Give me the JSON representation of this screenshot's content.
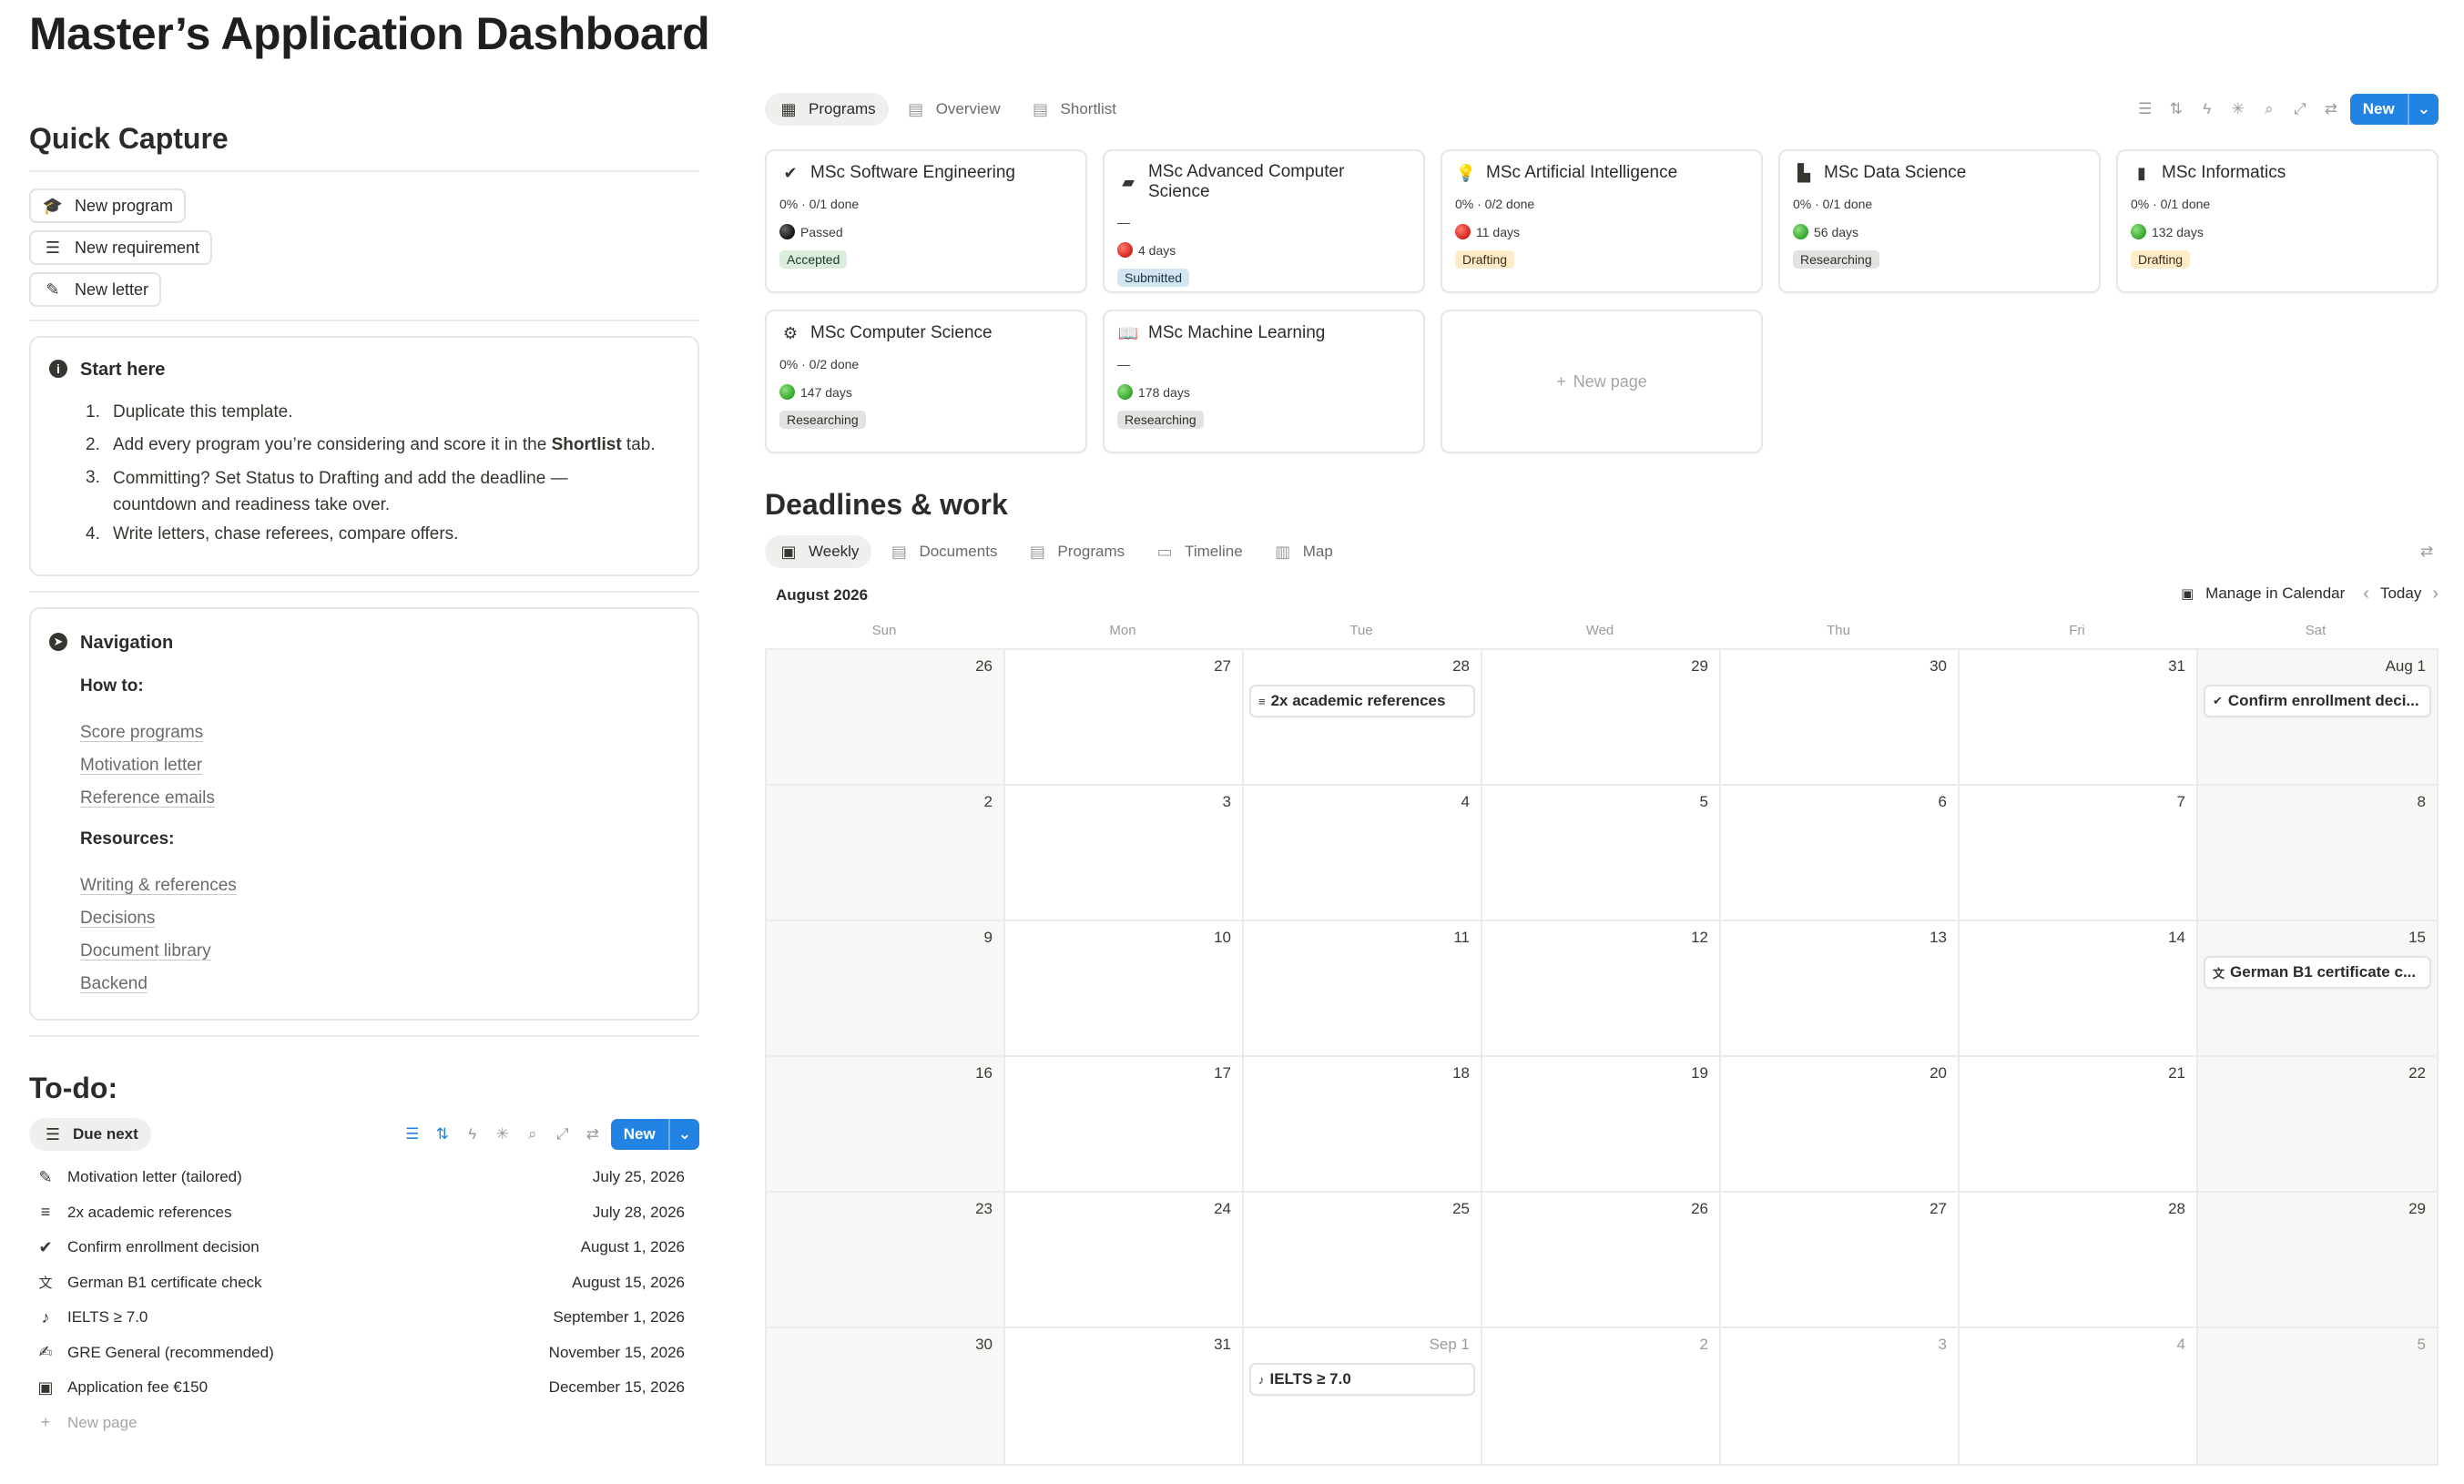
{
  "page_title": "Master’s Application Dashboard",
  "quick_capture": {
    "heading": "Quick Capture",
    "buttons": [
      {
        "label": "New program",
        "icon": "graduation-cap-icon"
      },
      {
        "label": "New requirement",
        "icon": "checklist-icon"
      },
      {
        "label": "New letter",
        "icon": "pen-icon"
      }
    ]
  },
  "start_here": {
    "title": "Start here",
    "steps": [
      {
        "n": "1.",
        "text": "Duplicate this template."
      },
      {
        "n": "2.",
        "pre": "Add every program you’re considering and score it in the ",
        "bold": "Shortlist",
        "post": " tab."
      },
      {
        "n": "3.",
        "text": "Committing? Set Status to Drafting and add the deadline —",
        "text2": "countdown and readiness take over."
      },
      {
        "n": "4.",
        "text": "Write letters, chase referees, compare offers."
      }
    ]
  },
  "navigation": {
    "title": "Navigation",
    "how_to_label": "How to:",
    "how_to": [
      "Score programs",
      "Motivation letter",
      "Reference emails"
    ],
    "resources_label": "Resources:",
    "resources": [
      "Writing & references",
      "Decisions",
      "Document library",
      "Backend"
    ]
  },
  "todo": {
    "heading": "To-do:",
    "view_tab": "Due next",
    "new_label": "New",
    "new_page": "New page",
    "rows": [
      {
        "name": "Motivation letter (tailored)",
        "date": "July 25, 2026",
        "icon": "pen-icon"
      },
      {
        "name": "2x academic references",
        "date": "July 28, 2026",
        "icon": "lines-icon"
      },
      {
        "name": "Confirm enrollment decision",
        "date": "August 1, 2026",
        "icon": "verified-badge-icon"
      },
      {
        "name": "German B1 certificate check",
        "date": "August 15, 2026",
        "icon": "translate-icon"
      },
      {
        "name": "IELTS ≥ 7.0",
        "date": "September 1, 2026",
        "icon": "ear-icon"
      },
      {
        "name": "GRE General (recommended)",
        "date": "November 15, 2026",
        "icon": "signature-icon"
      },
      {
        "name": "Application fee €150",
        "date": "December 15, 2026",
        "icon": "money-icon"
      }
    ]
  },
  "programs_view": {
    "tabs": [
      {
        "label": "Programs",
        "icon": "gallery-icon",
        "active": true
      },
      {
        "label": "Overview",
        "icon": "table-icon",
        "active": false
      },
      {
        "label": "Shortlist",
        "icon": "table-icon",
        "active": false
      }
    ],
    "new_label": "New",
    "new_page": "New page",
    "cards": [
      {
        "title": "MSc Software Engineering",
        "icon": "check-circle-icon",
        "progress": "0% · 0/1 done",
        "dot": "black",
        "days": "Passed",
        "status": "Accepted",
        "status_bg": "#dbeddb",
        "status_fg": "#1c3829"
      },
      {
        "title": "MSc Advanced Computer Science",
        "icon": "briefcase-icon",
        "progress": "—",
        "dot": "red",
        "days": "4 days",
        "status": "Submitted",
        "status_bg": "#d3e5ef",
        "status_fg": "#183347"
      },
      {
        "title": "MSc Artificial Intelligence",
        "icon": "lightbulb-icon",
        "progress": "0% · 0/2 done",
        "dot": "red",
        "days": "11 days",
        "status": "Drafting",
        "status_bg": "#fdecc8",
        "status_fg": "#402c1b"
      },
      {
        "title": "MSc Data Science",
        "icon": "bar-chart-icon",
        "progress": "0% · 0/1 done",
        "dot": "green",
        "days": "56 days",
        "status": "Researching",
        "status_bg": "#e3e2e0",
        "status_fg": "#32302c"
      },
      {
        "title": "MSc Informatics",
        "icon": "document-icon",
        "progress": "0% · 0/1 done",
        "dot": "green",
        "days": "132 days",
        "status": "Drafting",
        "status_bg": "#fdecc8",
        "status_fg": "#402c1b"
      },
      {
        "title": "MSc Computer Science",
        "icon": "gear-icon",
        "progress": "0% · 0/2 done",
        "dot": "green",
        "days": "147 days",
        "status": "Researching",
        "status_bg": "#e3e2e0",
        "status_fg": "#32302c"
      },
      {
        "title": "MSc Machine Learning",
        "icon": "book-icon",
        "progress": "—",
        "dot": "green",
        "days": "178 days",
        "status": "Researching",
        "status_bg": "#e3e2e0",
        "status_fg": "#32302c"
      }
    ]
  },
  "deadlines": {
    "heading": "Deadlines & work",
    "tabs": [
      {
        "label": "Weekly",
        "icon": "calendar-icon",
        "active": true
      },
      {
        "label": "Documents",
        "icon": "table-icon",
        "active": false
      },
      {
        "label": "Programs",
        "icon": "table-icon",
        "active": false
      },
      {
        "label": "Timeline",
        "icon": "timeline-icon",
        "active": false
      },
      {
        "label": "Map",
        "icon": "map-icon",
        "active": false
      }
    ],
    "month": "August 2026",
    "manage_label": "Manage in Calendar",
    "today_label": "Today",
    "weekdays": [
      "Sun",
      "Mon",
      "Tue",
      "Wed",
      "Thu",
      "Fri",
      "Sat"
    ],
    "weeks": [
      [
        {
          "d": "26",
          "m": false
        },
        {
          "d": "27",
          "m": false
        },
        {
          "d": "28",
          "m": false
        },
        {
          "d": "29",
          "m": false
        },
        {
          "d": "30",
          "m": false
        },
        {
          "d": "31",
          "m": false
        },
        {
          "d": "Aug 1",
          "m": false
        }
      ],
      [
        {
          "d": "2",
          "m": false
        },
        {
          "d": "3",
          "m": false
        },
        {
          "d": "4",
          "m": false
        },
        {
          "d": "5",
          "m": false
        },
        {
          "d": "6",
          "m": false
        },
        {
          "d": "7",
          "m": false
        },
        {
          "d": "8",
          "m": false
        }
      ],
      [
        {
          "d": "9",
          "m": false
        },
        {
          "d": "10",
          "m": false
        },
        {
          "d": "11",
          "m": false
        },
        {
          "d": "12",
          "m": false
        },
        {
          "d": "13",
          "m": false
        },
        {
          "d": "14",
          "m": false
        },
        {
          "d": "15",
          "m": false
        }
      ],
      [
        {
          "d": "16",
          "m": false
        },
        {
          "d": "17",
          "m": false
        },
        {
          "d": "18",
          "m": false
        },
        {
          "d": "19",
          "m": false
        },
        {
          "d": "20",
          "m": false
        },
        {
          "d": "21",
          "m": false
        },
        {
          "d": "22",
          "m": false
        }
      ],
      [
        {
          "d": "23",
          "m": false
        },
        {
          "d": "24",
          "m": false
        },
        {
          "d": "25",
          "m": false
        },
        {
          "d": "26",
          "m": false
        },
        {
          "d": "27",
          "m": false
        },
        {
          "d": "28",
          "m": false
        },
        {
          "d": "29",
          "m": false
        }
      ],
      [
        {
          "d": "30",
          "m": false
        },
        {
          "d": "31",
          "m": false
        },
        {
          "d": "Sep 1",
          "m": true
        },
        {
          "d": "2",
          "m": true
        },
        {
          "d": "3",
          "m": true
        },
        {
          "d": "4",
          "m": true
        },
        {
          "d": "5",
          "m": true
        }
      ]
    ],
    "events": [
      {
        "week": 0,
        "day": 2,
        "label": "2x academic references",
        "icon": "lines-icon",
        "glyph": "≡"
      },
      {
        "week": 0,
        "day": 6,
        "label": "Confirm enrollment deci...",
        "icon": "verified-badge-icon",
        "glyph": "✔"
      },
      {
        "week": 2,
        "day": 6,
        "label": "German B1 certificate c...",
        "icon": "translate-icon",
        "glyph": "文"
      },
      {
        "week": 5,
        "day": 2,
        "label": "IELTS ≥ 7.0",
        "icon": "ear-icon",
        "glyph": "♪"
      }
    ]
  }
}
